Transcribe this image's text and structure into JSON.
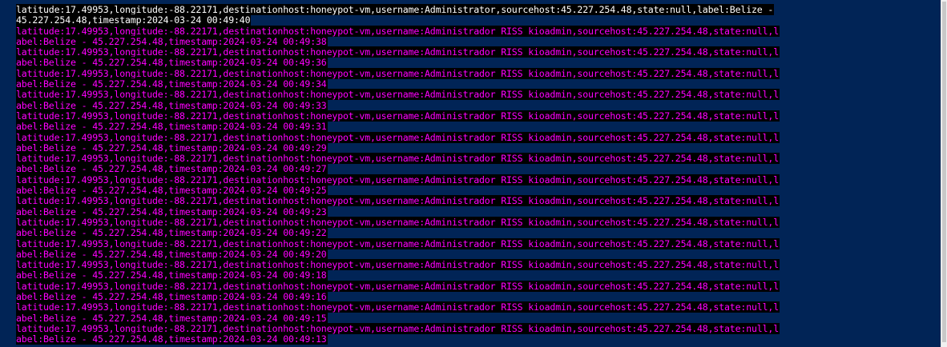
{
  "console": {
    "lines": [
      {
        "text": "latitude:17.49953,longitude:-88.22171,destinationhost:honeypot-vm,username:Administrator,sourcehost:45.227.254.48,state:null,label:Belize -",
        "color": "white"
      },
      {
        "text": "45.227.254.48,timestamp:2024-03-24 00:49:40",
        "color": "white"
      },
      {
        "text": "latitude:17.49953,longitude:-88.22171,destinationhost:honeypot-vm,username:Administrador RISS kioadmin,sourcehost:45.227.254.48,state:null,l",
        "color": "magenta"
      },
      {
        "text": "abel:Belize - 45.227.254.48,timestamp:2024-03-24 00:49:38",
        "color": "magenta"
      },
      {
        "text": "latitude:17.49953,longitude:-88.22171,destinationhost:honeypot-vm,username:Administrador RISS kioadmin,sourcehost:45.227.254.48,state:null,l",
        "color": "magenta"
      },
      {
        "text": "abel:Belize - 45.227.254.48,timestamp:2024-03-24 00:49:36",
        "color": "magenta"
      },
      {
        "text": "latitude:17.49953,longitude:-88.22171,destinationhost:honeypot-vm,username:Administrador RISS kioadmin,sourcehost:45.227.254.48,state:null,l",
        "color": "magenta"
      },
      {
        "text": "abel:Belize - 45.227.254.48,timestamp:2024-03-24 00:49:34",
        "color": "magenta"
      },
      {
        "text": "latitude:17.49953,longitude:-88.22171,destinationhost:honeypot-vm,username:Administrador RISS kioadmin,sourcehost:45.227.254.48,state:null,l",
        "color": "magenta"
      },
      {
        "text": "abel:Belize - 45.227.254.48,timestamp:2024-03-24 00:49:33",
        "color": "magenta"
      },
      {
        "text": "latitude:17.49953,longitude:-88.22171,destinationhost:honeypot-vm,username:Administrador RISS kioadmin,sourcehost:45.227.254.48,state:null,l",
        "color": "magenta"
      },
      {
        "text": "abel:Belize - 45.227.254.48,timestamp:2024-03-24 00:49:31",
        "color": "magenta"
      },
      {
        "text": "latitude:17.49953,longitude:-88.22171,destinationhost:honeypot-vm,username:Administrador RISS kioadmin,sourcehost:45.227.254.48,state:null,l",
        "color": "magenta"
      },
      {
        "text": "abel:Belize - 45.227.254.48,timestamp:2024-03-24 00:49:29",
        "color": "magenta"
      },
      {
        "text": "latitude:17.49953,longitude:-88.22171,destinationhost:honeypot-vm,username:Administrador RISS kioadmin,sourcehost:45.227.254.48,state:null,l",
        "color": "magenta"
      },
      {
        "text": "abel:Belize - 45.227.254.48,timestamp:2024-03-24 00:49:27",
        "color": "magenta"
      },
      {
        "text": "latitude:17.49953,longitude:-88.22171,destinationhost:honeypot-vm,username:Administrador RISS kioadmin,sourcehost:45.227.254.48,state:null,l",
        "color": "magenta"
      },
      {
        "text": "abel:Belize - 45.227.254.48,timestamp:2024-03-24 00:49:25",
        "color": "magenta"
      },
      {
        "text": "latitude:17.49953,longitude:-88.22171,destinationhost:honeypot-vm,username:Administrador RISS kioadmin,sourcehost:45.227.254.48,state:null,l",
        "color": "magenta"
      },
      {
        "text": "abel:Belize - 45.227.254.48,timestamp:2024-03-24 00:49:23",
        "color": "magenta"
      },
      {
        "text": "latitude:17.49953,longitude:-88.22171,destinationhost:honeypot-vm,username:Administrador RISS kioadmin,sourcehost:45.227.254.48,state:null,l",
        "color": "magenta"
      },
      {
        "text": "abel:Belize - 45.227.254.48,timestamp:2024-03-24 00:49:22",
        "color": "magenta"
      },
      {
        "text": "latitude:17.49953,longitude:-88.22171,destinationhost:honeypot-vm,username:Administrador RISS kioadmin,sourcehost:45.227.254.48,state:null,l",
        "color": "magenta"
      },
      {
        "text": "abel:Belize - 45.227.254.48,timestamp:2024-03-24 00:49:20",
        "color": "magenta"
      },
      {
        "text": "latitude:17.49953,longitude:-88.22171,destinationhost:honeypot-vm,username:Administrador RISS kioadmin,sourcehost:45.227.254.48,state:null,l",
        "color": "magenta"
      },
      {
        "text": "abel:Belize - 45.227.254.48,timestamp:2024-03-24 00:49:18",
        "color": "magenta"
      },
      {
        "text": "latitude:17.49953,longitude:-88.22171,destinationhost:honeypot-vm,username:Administrador RISS kioadmin,sourcehost:45.227.254.48,state:null,l",
        "color": "magenta"
      },
      {
        "text": "abel:Belize - 45.227.254.48,timestamp:2024-03-24 00:49:16",
        "color": "magenta"
      },
      {
        "text": "latitude:17.49953,longitude:-88.22171,destinationhost:honeypot-vm,username:Administrador RISS kioadmin,sourcehost:45.227.254.48,state:null,l",
        "color": "magenta"
      },
      {
        "text": "abel:Belize - 45.227.254.48,timestamp:2024-03-24 00:49:15",
        "color": "magenta"
      },
      {
        "text": "latitude:17.49953,longitude:-88.22171,destinationhost:honeypot-vm,username:Administrador RISS kioadmin,sourcehost:45.227.254.48,state:null,l",
        "color": "magenta"
      },
      {
        "text": "abel:Belize - 45.227.254.48,timestamp:2024-03-24 00:49:13",
        "color": "magenta"
      }
    ]
  },
  "colors": {
    "console_background": "#012456",
    "text_background": "#000000",
    "white_text": "#ffffff",
    "magenta_text": "#ff00ff"
  }
}
